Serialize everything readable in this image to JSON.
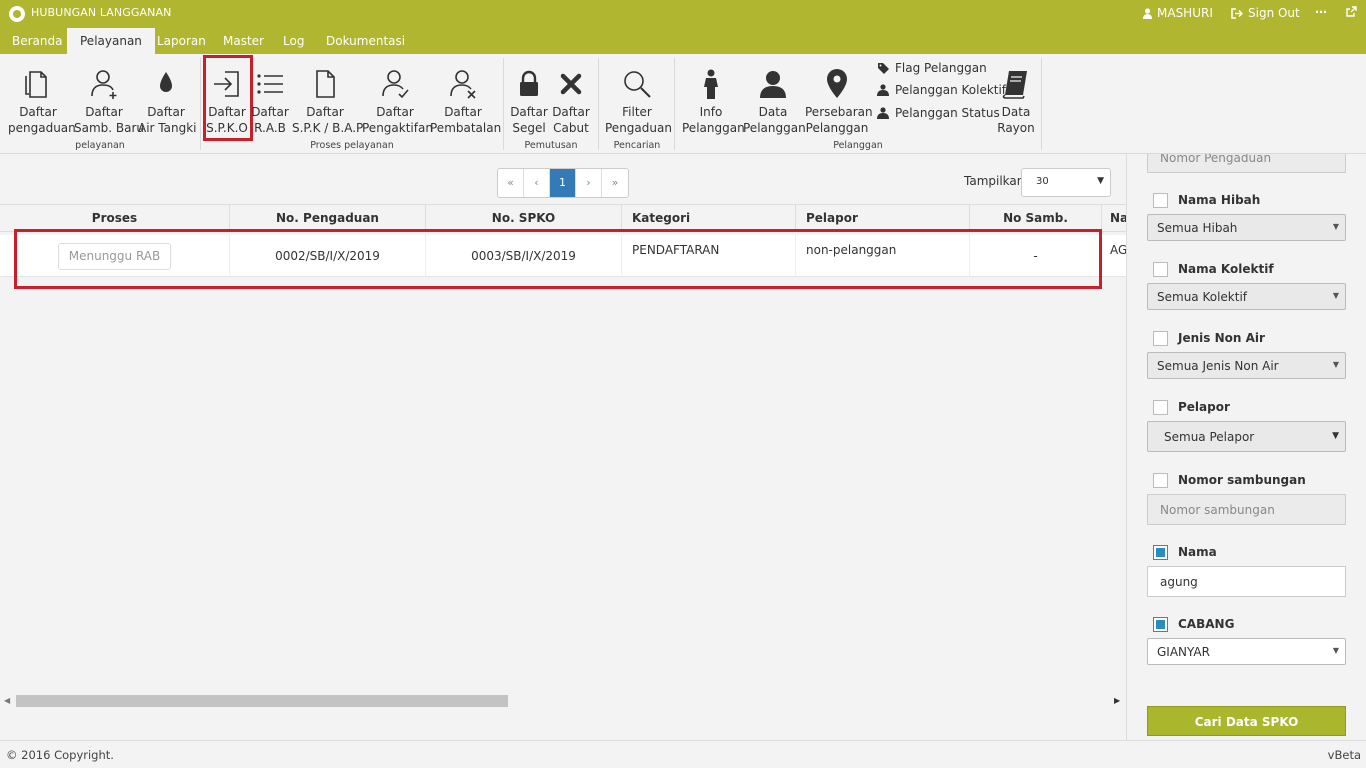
{
  "app": {
    "title": "HUBUNGAN LANGGANAN"
  },
  "top": {
    "user": "MASHURI",
    "signout": "Sign Out",
    "more": "⋯"
  },
  "menu": {
    "tabs": [
      "Beranda",
      "Pelayanan",
      "Laporan",
      "Master",
      "Log",
      "Dokumentasi"
    ],
    "active": "Pelayanan"
  },
  "ribbon": {
    "buttons": [
      {
        "line1": "Daftar",
        "line2": "pengaduan"
      },
      {
        "line1": "Daftar",
        "line2": "Samb. Baru"
      },
      {
        "line1": "Daftar",
        "line2": "Air Tangki"
      },
      {
        "line1": "Daftar",
        "line2": "S.P.K.O"
      },
      {
        "line1": "Daftar",
        "line2": "R.A.B"
      },
      {
        "line1": "Daftar",
        "line2": "S.P.K / B.A.P"
      },
      {
        "line1": "Daftar",
        "line2": "Pengaktifan"
      },
      {
        "line1": "Daftar",
        "line2": "Pembatalan"
      },
      {
        "line1": "Daftar",
        "line2": "Segel"
      },
      {
        "line1": "Daftar",
        "line2": "Cabut"
      },
      {
        "line1": "Filter",
        "line2": "Pengaduan"
      },
      {
        "line1": "Info",
        "line2": "Pelanggan"
      },
      {
        "line1": "Data",
        "line2": "Pelanggan"
      },
      {
        "line1": "Persebaran",
        "line2": "Pelanggan"
      },
      {
        "line1": "Data",
        "line2": "Rayon"
      }
    ],
    "small_items": [
      "Flag Pelanggan",
      "Pelanggan Kolektif",
      "Pelanggan Status"
    ],
    "groups": [
      "pelayanan",
      "Proses pelayanan",
      "Pemutusan",
      "Pencarian",
      "Pelanggan"
    ]
  },
  "pagination": {
    "first": "«",
    "prev": "‹",
    "current": "1",
    "next": "›",
    "last": "»"
  },
  "show": {
    "label": "Tampilkan",
    "value": "30"
  },
  "table": {
    "columns": [
      "Proses",
      "No. Pengaduan",
      "No. SPKO",
      "Kategori",
      "Pelapor",
      "No Samb.",
      "Na"
    ],
    "rows": [
      {
        "proses": "Menunggu RAB",
        "no_pengaduan": "0002/SB/I/X/2019",
        "no_spko": "0003/SB/I/X/2019",
        "kategori": "PENDAFTARAN",
        "pelapor": "non-pelanggan",
        "no_samb": "-",
        "nama": "AG"
      }
    ]
  },
  "filters": {
    "nomor_pengaduan_placeholder": "Nomor Pengaduan",
    "hibah": {
      "label": "Nama Hibah",
      "value": "Semua Hibah",
      "checked": false
    },
    "kolektif": {
      "label": "Nama Kolektif",
      "value": "Semua Kolektif",
      "checked": false
    },
    "non_air": {
      "label": "Jenis Non Air",
      "value": "Semua Jenis Non Air",
      "checked": false
    },
    "pelapor": {
      "label": "Pelapor",
      "value": "Semua Pelapor",
      "checked": false
    },
    "sambungan": {
      "label": "Nomor sambungan",
      "placeholder": "Nomor sambungan",
      "checked": false
    },
    "nama": {
      "label": "Nama",
      "value": "agung",
      "checked": true
    },
    "cabang": {
      "label": "CABANG",
      "value": "GIANYAR",
      "checked": true
    },
    "search_button": "Cari Data SPKO"
  },
  "footer": {
    "copyright": "© 2016 Copyright.",
    "version": "vBeta"
  },
  "colors": {
    "brand": "#b0b62f",
    "highlight": "#c8202a",
    "active_page": "#337ab7",
    "checkbox": "#2a8cbf"
  }
}
